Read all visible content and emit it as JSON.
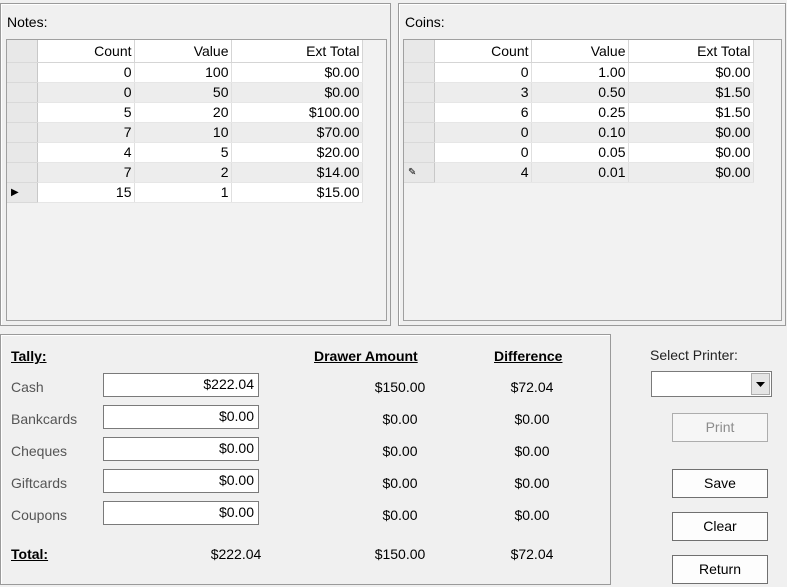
{
  "notes": {
    "title": "Notes:",
    "columns": [
      "Count",
      "Value",
      "Ext Total"
    ],
    "rows": [
      {
        "marker": "",
        "count": "0",
        "value": "100",
        "ext": "$0.00"
      },
      {
        "marker": "",
        "count": "0",
        "value": "50",
        "ext": "$0.00"
      },
      {
        "marker": "",
        "count": "5",
        "value": "20",
        "ext": "$100.00"
      },
      {
        "marker": "",
        "count": "7",
        "value": "10",
        "ext": "$70.00"
      },
      {
        "marker": "",
        "count": "4",
        "value": "5",
        "ext": "$20.00"
      },
      {
        "marker": "",
        "count": "7",
        "value": "2",
        "ext": "$14.00"
      },
      {
        "marker": "▶",
        "count": "15",
        "value": "1",
        "ext": "$15.00"
      }
    ]
  },
  "coins": {
    "title": "Coins:",
    "columns": [
      "Count",
      "Value",
      "Ext Total"
    ],
    "rows": [
      {
        "marker": "",
        "count": "0",
        "value": "1.00",
        "ext": "$0.00"
      },
      {
        "marker": "",
        "count": "3",
        "value": "0.50",
        "ext": "$1.50"
      },
      {
        "marker": "",
        "count": "6",
        "value": "0.25",
        "ext": "$1.50"
      },
      {
        "marker": "",
        "count": "0",
        "value": "0.10",
        "ext": "$0.00"
      },
      {
        "marker": "",
        "count": "0",
        "value": "0.05",
        "ext": "$0.00"
      },
      {
        "marker": "✎",
        "count": "4",
        "value": "0.01",
        "ext": "$0.00"
      }
    ]
  },
  "tally": {
    "heading": "Tally:",
    "drawer_heading": "Drawer Amount",
    "difference_heading": "Difference",
    "rows": [
      {
        "label": "Cash",
        "field": "$222.04",
        "drawer": "$150.00",
        "difference": "$72.04"
      },
      {
        "label": "Bankcards",
        "field": "$0.00",
        "drawer": "$0.00",
        "difference": "$0.00"
      },
      {
        "label": "Cheques",
        "field": "$0.00",
        "drawer": "$0.00",
        "difference": "$0.00"
      },
      {
        "label": "Giftcards",
        "field": "$0.00",
        "drawer": "$0.00",
        "difference": "$0.00"
      },
      {
        "label": "Coupons",
        "field": "$0.00",
        "drawer": "$0.00",
        "difference": "$0.00"
      }
    ],
    "total_label": "Total:",
    "total_amount": "$222.04",
    "total_drawer": "$150.00",
    "total_difference": "$72.04"
  },
  "printer": {
    "label": "Select Printer:",
    "selected": "",
    "dropdown_icon": "chevron-down-icon"
  },
  "buttons": {
    "print": "Print",
    "save": "Save",
    "clear": "Clear",
    "return": "Return"
  }
}
